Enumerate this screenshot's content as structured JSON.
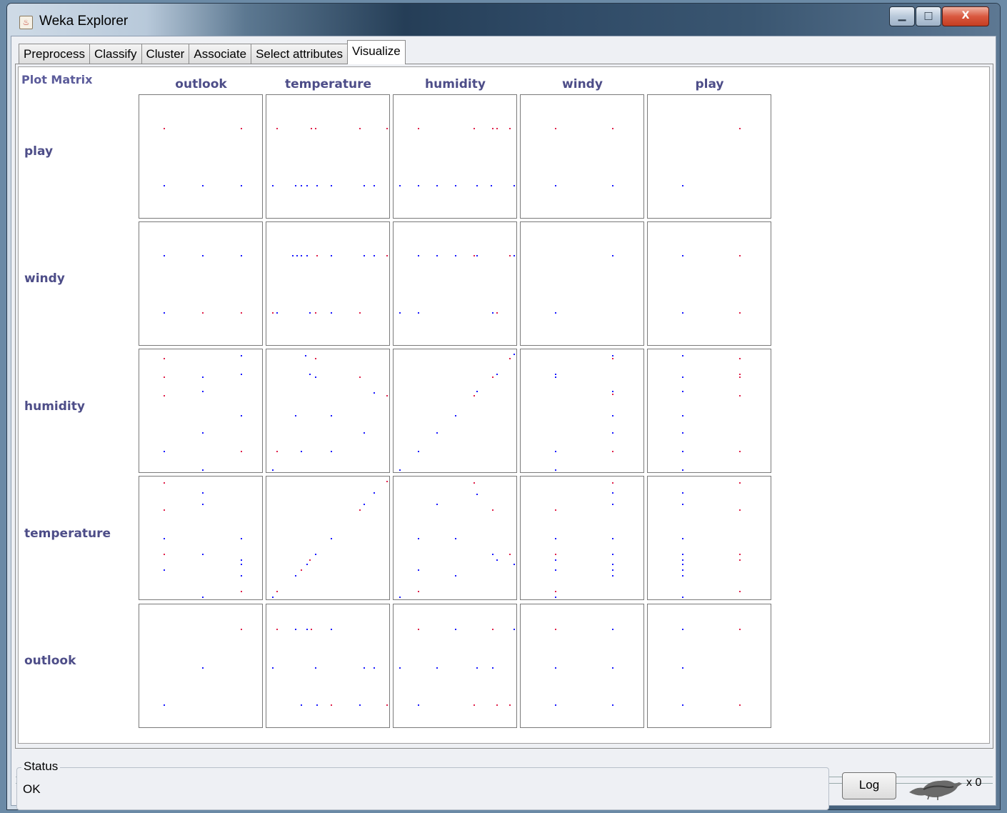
{
  "window": {
    "title": "Weka Explorer"
  },
  "window_controls": {
    "minimize": "▁",
    "maximize": "□",
    "close": "X"
  },
  "tabs": [
    "Preprocess",
    "Classify",
    "Cluster",
    "Associate",
    "Select attributes",
    "Visualize"
  ],
  "active_tab": "Visualize",
  "plot_matrix": {
    "title": "Plot Matrix",
    "columns": [
      "outlook",
      "temperature",
      "humidity",
      "windy",
      "play"
    ],
    "rows": [
      "play",
      "windy",
      "humidity",
      "temperature",
      "outlook"
    ],
    "point_colors": {
      "blue": "#1818ff",
      "red": "#e0204a"
    }
  },
  "status": {
    "label": "Status",
    "text": "OK"
  },
  "log_button": "Log",
  "task_count": "x 0"
}
